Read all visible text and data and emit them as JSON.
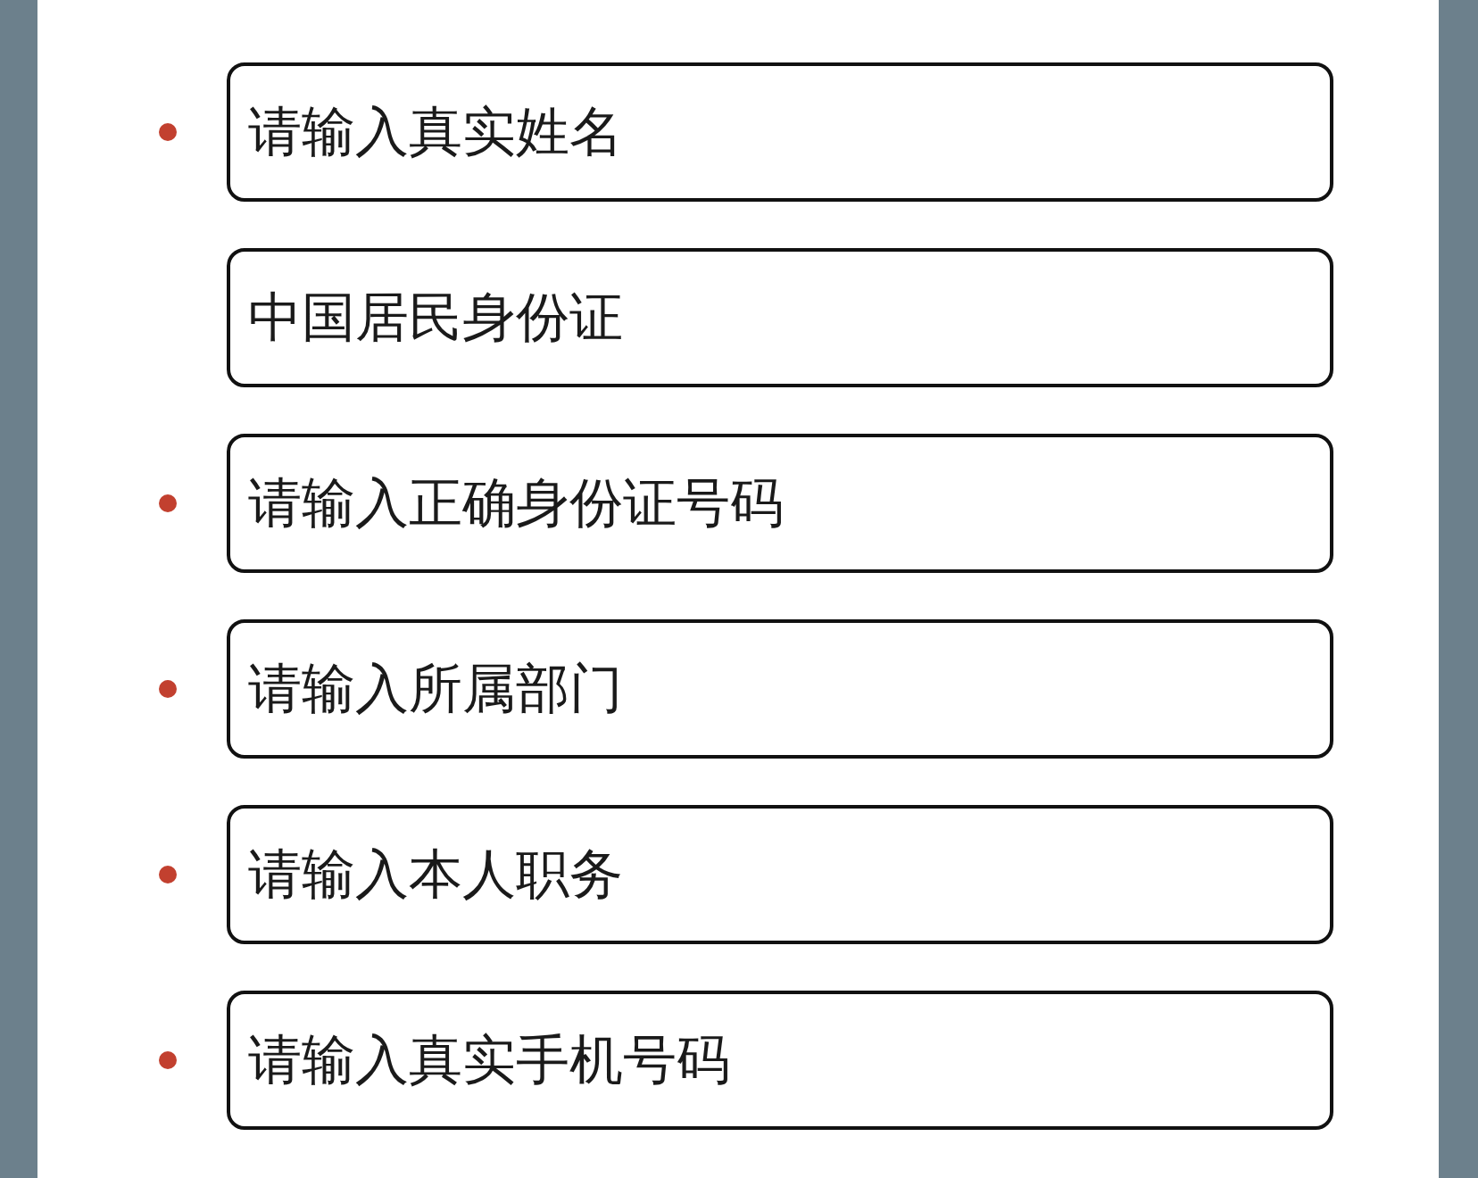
{
  "fields": [
    {
      "required": true,
      "placeholder": "请输入真实姓名"
    },
    {
      "required": false,
      "value": "中国居民身份证"
    },
    {
      "required": true,
      "placeholder": "请输入正确身份证号码"
    },
    {
      "required": true,
      "placeholder": "请输入所属部门"
    },
    {
      "required": true,
      "placeholder": "请输入本人职务"
    },
    {
      "required": true,
      "placeholder": "请输入真实手机号码"
    }
  ]
}
